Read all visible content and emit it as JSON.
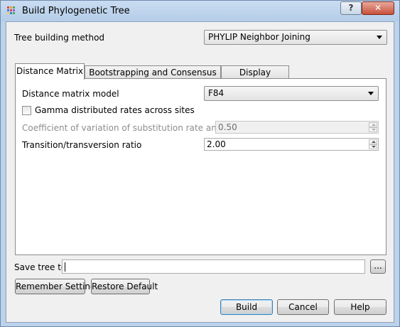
{
  "window": {
    "title": "Build Phylogenetic Tree",
    "help_label": "?",
    "close_label": "✕",
    "icon_colors": [
      "#e04a4a",
      "#f29b38",
      "#4caf50",
      "#3f7fd6",
      "#e04a4a",
      "#9c5fcf",
      "#f2c94c",
      "#3f7fd6",
      "#4caf50"
    ]
  },
  "method": {
    "label": "Tree building method",
    "value": "PHYLIP Neighbor Joining"
  },
  "tabs": [
    {
      "label": "Distance Matrix",
      "active": true
    },
    {
      "label": "Bootstrapping and Consensus Tree",
      "active": false
    },
    {
      "label": "Display Options",
      "active": false
    }
  ],
  "distance": {
    "model_label": "Distance matrix model",
    "model_value": "F84",
    "gamma_label": "Gamma distributed rates across sites",
    "gamma_checked": false,
    "coef_label": "Coefficient of variation of substitution rate among sites",
    "coef_value": "0.50",
    "ratio_label": "Transition/transversion ratio",
    "ratio_value": "2.00"
  },
  "save": {
    "label": "Save tree to",
    "value": "",
    "browse_label": "..."
  },
  "buttons": {
    "remember": "Remember Settings",
    "restore": "Restore Default",
    "build": "Build",
    "cancel": "Cancel",
    "help": "Help"
  }
}
